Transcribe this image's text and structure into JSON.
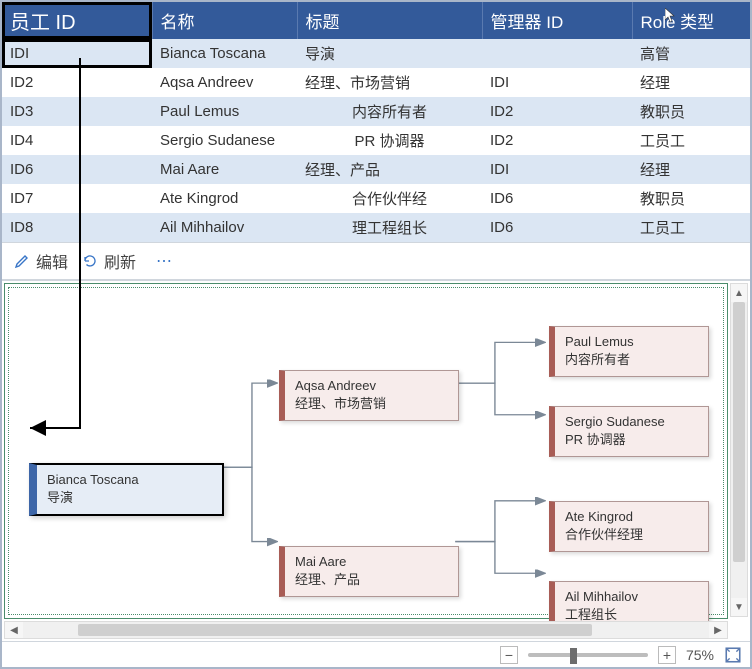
{
  "headers": {
    "emp_id": "员工 ID",
    "name": "名称",
    "title": "标题",
    "mgr_id": "管理器 ID",
    "role": "Role 类型"
  },
  "rows": [
    {
      "id": "IDI",
      "name": "Bianca Toscana",
      "title": "导演",
      "mgr": "",
      "role": "高管"
    },
    {
      "id": "ID2",
      "name": "Aqsa Andreev",
      "title": "经理、市场营销",
      "mgr": "IDI",
      "role": "经理"
    },
    {
      "id": "ID3",
      "name": "Paul Lemus",
      "title": "内容所有者",
      "mgr": "ID2",
      "role": "教职员"
    },
    {
      "id": "ID4",
      "name": "Sergio Sudanese",
      "title": "PR 协调器",
      "mgr": "ID2",
      "role": "工员工"
    },
    {
      "id": "ID6",
      "name": "Mai Aare",
      "title": "经理、产品",
      "mgr": "IDI",
      "role": "经理"
    },
    {
      "id": "ID7",
      "name": "Ate Kingrod",
      "title": "合作伙伴经",
      "mgr": "ID6",
      "role": "教职员"
    },
    {
      "id": "ID8",
      "name": "Ail Mihhailov",
      "title": "理工程组长",
      "mgr": "ID6",
      "role": "工员工"
    }
  ],
  "toolbar": {
    "edit": "编辑",
    "refresh": "刷新",
    "more": "⋯"
  },
  "nodes": {
    "root": {
      "name": "Bianca Toscana",
      "title": "导演"
    },
    "aqsa": {
      "name": "Aqsa Andreev",
      "title": "经理、市场营销"
    },
    "mai": {
      "name": "Mai Aare",
      "title": "经理、产品"
    },
    "paul": {
      "name": "Paul Lemus",
      "title": "内容所有者"
    },
    "sergio": {
      "name": "Sergio Sudanese",
      "title": "PR 协调器"
    },
    "ate": {
      "name": "Ate Kingrod",
      "title": "合作伙伴经理"
    },
    "ail": {
      "name": "Ail Mihhailov",
      "title": "工程组长"
    }
  },
  "zoom": {
    "pct": "75%",
    "handle_left_pct": 35
  }
}
